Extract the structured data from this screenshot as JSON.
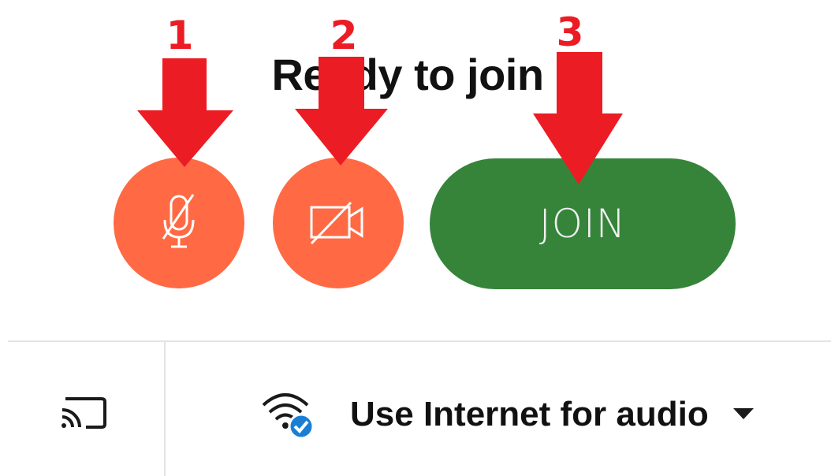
{
  "dialog": {
    "title": "Ready to join"
  },
  "controls": {
    "mic_button_icon": "mic-off-icon",
    "camera_button_icon": "video-off-icon",
    "join_label": "JOIN"
  },
  "footer": {
    "cast_icon": "cast-icon",
    "audio_icon": "wifi-check-icon",
    "audio_label": "Use Internet for audio",
    "audio_dropdown_icon": "caret-down-icon"
  },
  "annotations": {
    "markers": [
      "1",
      "2",
      "3"
    ]
  },
  "colors": {
    "muted_button": "#ff6a44",
    "join_button": "#36843a",
    "annotation_red": "#ec1c24",
    "check_badge": "#1a7fd4",
    "divider": "#e3e3e3"
  }
}
